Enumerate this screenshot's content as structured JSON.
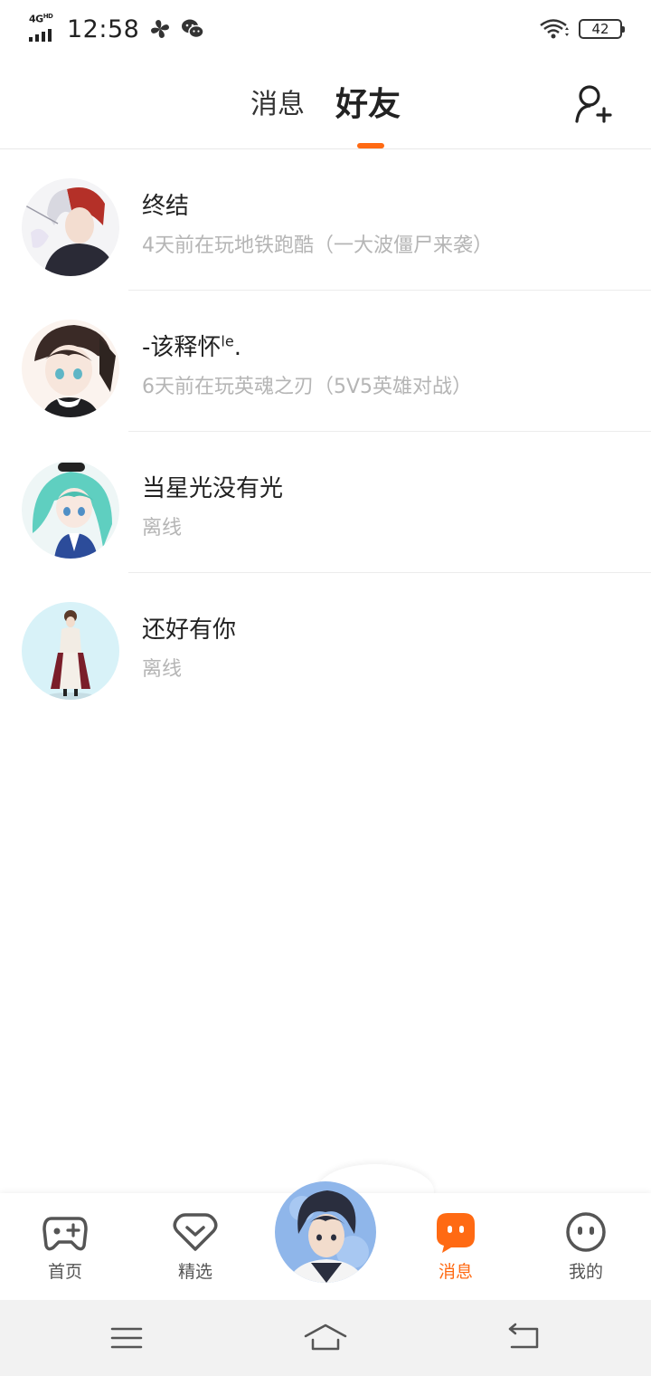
{
  "status_bar": {
    "network": "4G",
    "network_sup": "HD",
    "time": "12:58",
    "battery": "42"
  },
  "header": {
    "tabs": [
      {
        "label": "消息",
        "active": false
      },
      {
        "label": "好友",
        "active": true
      }
    ],
    "accent_color": "#ff6a13"
  },
  "friends": [
    {
      "name": "终结",
      "name_sup": "",
      "status": "4天前在玩地铁跑酷（一大波僵尸来袭）"
    },
    {
      "name": "-该释怀",
      "name_sup": "le",
      "name_suffix": ".",
      "status": "6天前在玩英魂之刃（5V5英雄对战）"
    },
    {
      "name": "当星光没有光",
      "name_sup": "",
      "status": "离线"
    },
    {
      "name": "还好有你",
      "name_sup": "",
      "status": "离线"
    }
  ],
  "bottom_nav": {
    "items": [
      {
        "label": "首页",
        "icon": "gamepad-icon",
        "active": false
      },
      {
        "label": "精选",
        "icon": "heart-icon",
        "active": false
      },
      {
        "label": "消息",
        "icon": "message-icon",
        "active": true
      },
      {
        "label": "我的",
        "icon": "face-icon",
        "active": false
      }
    ]
  },
  "system_nav": {
    "icons": [
      "menu-icon",
      "home-icon",
      "back-icon"
    ]
  }
}
